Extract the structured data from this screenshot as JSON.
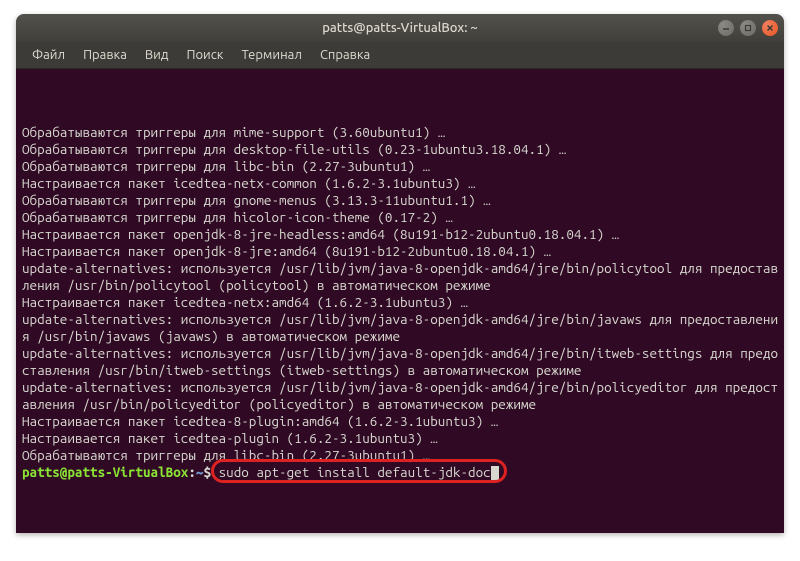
{
  "window": {
    "title": "patts@patts-VirtualBox: ~"
  },
  "menubar": {
    "items": [
      "Файл",
      "Правка",
      "Вид",
      "Поиск",
      "Терминал",
      "Справка"
    ]
  },
  "terminal": {
    "lines": [
      "Обрабатываются триггеры для mime-support (3.60ubuntu1) …",
      "Обрабатываются триггеры для desktop-file-utils (0.23-1ubuntu3.18.04.1) …",
      "Обрабатываются триггеры для libc-bin (2.27-3ubuntu1) …",
      "Настраивается пакет icedtea-netx-common (1.6.2-3.1ubuntu3) …",
      "Обрабатываются триггеры для gnome-menus (3.13.3-11ubuntu1.1) …",
      "Обрабатываются триггеры для hicolor-icon-theme (0.17-2) …",
      "Настраивается пакет openjdk-8-jre-headless:amd64 (8u191-b12-2ubuntu0.18.04.1) …",
      "Настраивается пакет openjdk-8-jre:amd64 (8u191-b12-2ubuntu0.18.04.1) …",
      "update-alternatives: используется /usr/lib/jvm/java-8-openjdk-amd64/jre/bin/policytool для предоставления /usr/bin/policytool (policytool) в автоматическом режиме",
      "Настраивается пакет icedtea-netx:amd64 (1.6.2-3.1ubuntu3) …",
      "update-alternatives: используется /usr/lib/jvm/java-8-openjdk-amd64/jre/bin/javaws для предоставления /usr/bin/javaws (javaws) в автоматическом режиме",
      "update-alternatives: используется /usr/lib/jvm/java-8-openjdk-amd64/jre/bin/itweb-settings для предоставления /usr/bin/itweb-settings (itweb-settings) в автоматическом режиме",
      "update-alternatives: используется /usr/lib/jvm/java-8-openjdk-amd64/jre/bin/policyeditor для предоставления /usr/bin/policyeditor (policyeditor) в автоматическом режиме",
      "Настраивается пакет icedtea-8-plugin:amd64 (1.6.2-3.1ubuntu3) …",
      "Настраивается пакет icedtea-plugin (1.6.2-3.1ubuntu3) …",
      "Обрабатываются триггеры для libc-bin (2.27-3ubuntu1) …"
    ],
    "prompt": {
      "user_host": "patts@patts-VirtualBox",
      "path": "~",
      "command": "sudo apt-get install default-jdk-doc"
    }
  }
}
